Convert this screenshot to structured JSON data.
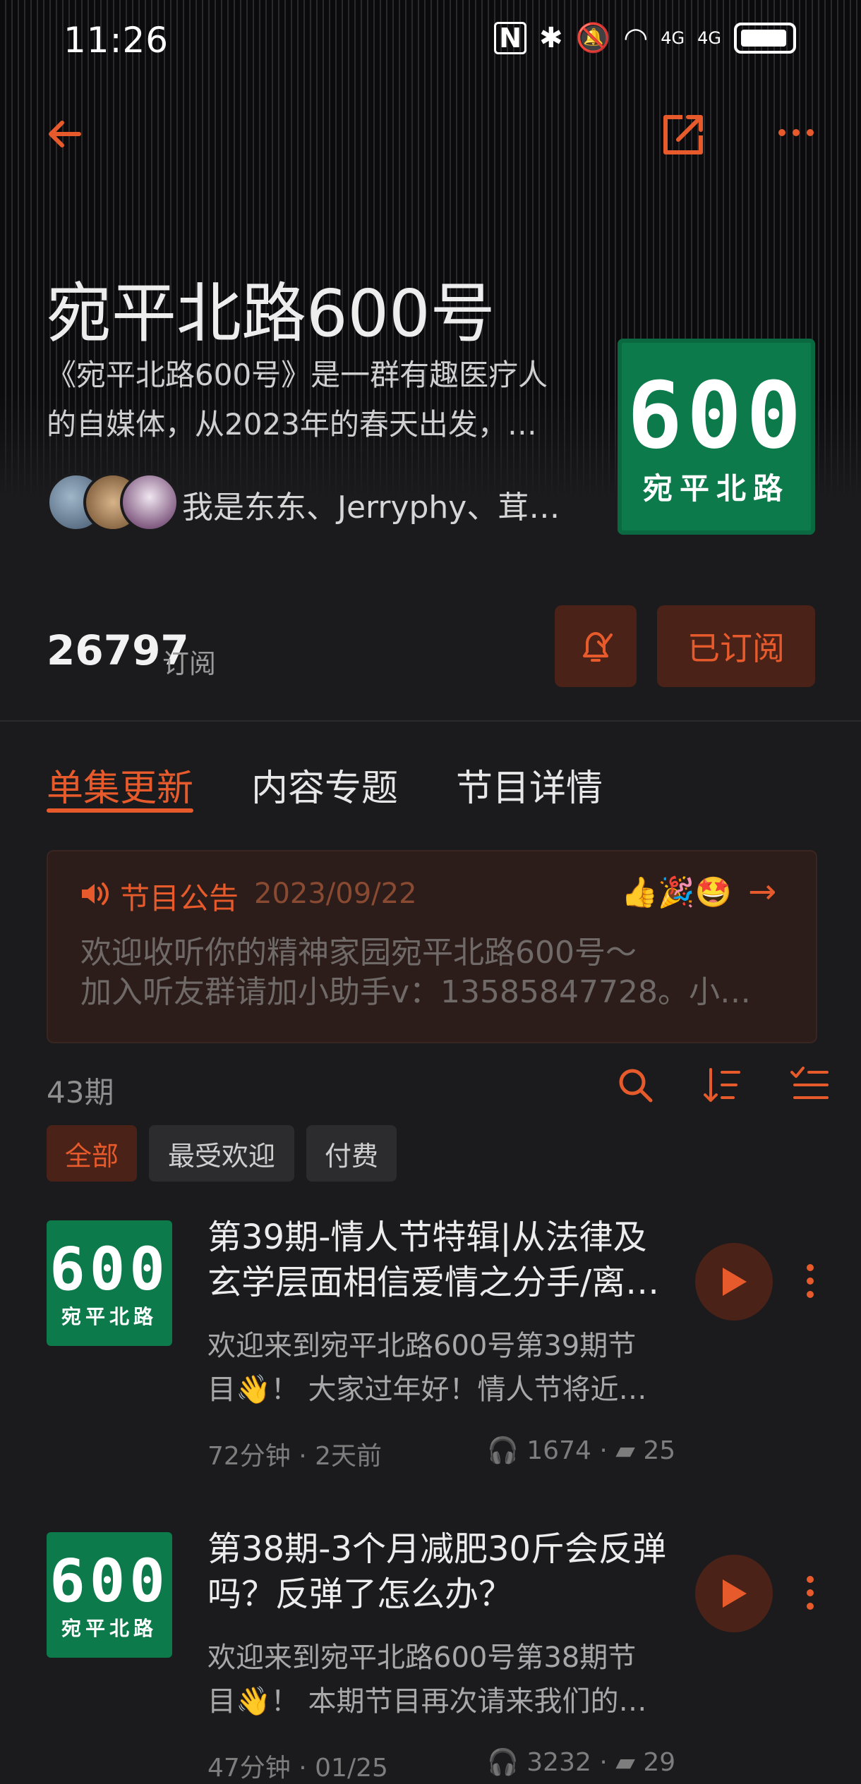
{
  "status_bar": {
    "time": "11:26",
    "nfc": "N",
    "network_4g_1": "4G",
    "network_4g_2": "4G"
  },
  "nav": {
    "back_icon": "arrow-left",
    "share_icon": "share",
    "more_icon": "more-horizontal"
  },
  "podcast": {
    "title": "宛平北路600号",
    "description_line1": "《宛平北路600号》是一群有趣医疗人",
    "description_line2": "的自媒体，从2023年的春天出发，…",
    "hosts": "我是东东、Jerryphy、茸…",
    "cover_number": "600",
    "cover_road": "宛平北路"
  },
  "subscription": {
    "count": "26797",
    "label": "订阅",
    "subscribed_label": "已订阅"
  },
  "tabs": [
    {
      "label": "单集更新",
      "active": true
    },
    {
      "label": "内容专题",
      "active": false
    },
    {
      "label": "节目详情",
      "active": false
    }
  ],
  "notice": {
    "label": "节目公告",
    "date": "2023/09/22",
    "emoji": "👍🎉🤩",
    "line1": "欢迎收听你的精神家园宛平北路600号～",
    "line2": "加入听友群请加小助手v：13585847728。小…"
  },
  "episodes_header": {
    "count": "43期"
  },
  "filters": [
    "全部",
    "最受欢迎",
    "付费"
  ],
  "episodes": [
    {
      "title_line1": "第39期-情人节特辑|从法律及",
      "title_line2": "玄学层面相信爱情之分手/离…",
      "desc_line1": "欢迎来到宛平北路600号第39期节",
      "desc_line2": "目👋！ 大家过年好！情人节将近…",
      "duration_time": "72分钟 · 2天前",
      "plays": "1674 ·",
      "comments": "25"
    },
    {
      "title_line1": "第38期-3个月减肥30斤会反弹",
      "title_line2": "吗？反弹了怎么办？",
      "desc_line1": "欢迎来到宛平北路600号第38期节",
      "desc_line2": "目👋！ 本期节目再次请来我们的…",
      "duration_time": "47分钟 · 01/25",
      "plays": "3232 ·",
      "comments": "29"
    }
  ],
  "colors": {
    "accent": "#e65a2b",
    "cover_green": "#0c7a4a",
    "background": "#1b1b1d"
  }
}
